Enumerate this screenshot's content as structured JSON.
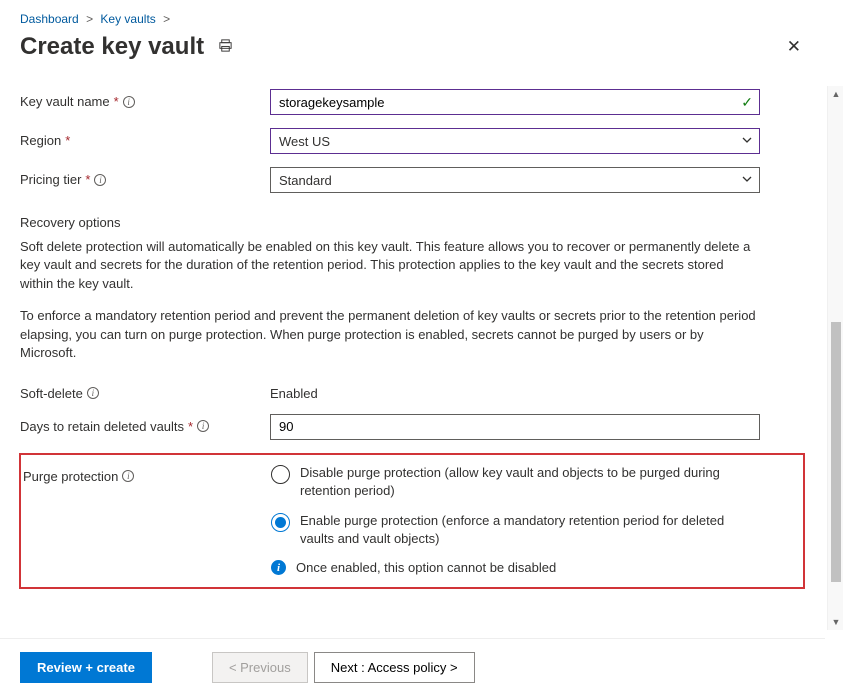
{
  "breadcrumb": {
    "item1": "Dashboard",
    "item2": "Key vaults"
  },
  "title": "Create key vault",
  "fields": {
    "name_label": "Key vault name",
    "name_value": "storagekeysample",
    "region_label": "Region",
    "region_value": "West US",
    "tier_label": "Pricing tier",
    "tier_value": "Standard"
  },
  "recovery": {
    "header": "Recovery options",
    "para1": "Soft delete protection will automatically be enabled on this key vault. This feature allows you to recover or permanently delete a key vault and secrets for the duration of the retention period. This protection applies to the key vault and the secrets stored within the key vault.",
    "para2": "To enforce a mandatory retention period and prevent the permanent deletion of key vaults or secrets prior to the retention period elapsing, you can turn on purge protection. When purge protection is enabled, secrets cannot be purged by users or by Microsoft.",
    "softdelete_label": "Soft-delete",
    "softdelete_value": "Enabled",
    "retain_label": "Days to retain deleted vaults",
    "retain_value": "90",
    "purge_label": "Purge protection",
    "radio_disable": "Disable purge protection (allow key vault and objects to be purged during retention period)",
    "radio_enable": "Enable purge protection (enforce a mandatory retention period for deleted vaults and vault objects)",
    "note": "Once enabled, this option cannot be disabled"
  },
  "footer": {
    "review": "Review + create",
    "prev": "< Previous",
    "next": "Next : Access policy >"
  }
}
